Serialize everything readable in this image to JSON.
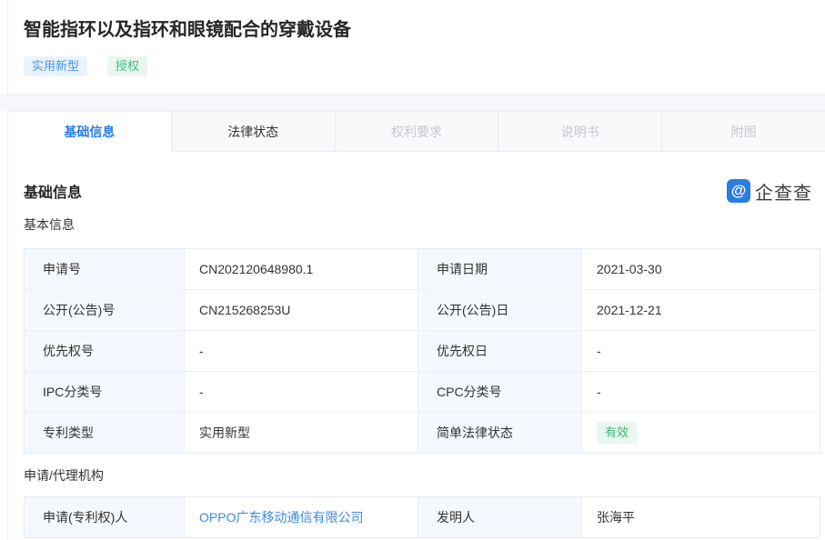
{
  "header": {
    "title": "智能指环以及指环和眼镜配合的穿戴设备",
    "tags": [
      {
        "id": "utility-model",
        "label": "实用新型",
        "style": "blue"
      },
      {
        "id": "granted",
        "label": "授权",
        "style": "green"
      }
    ]
  },
  "tabs": [
    {
      "id": "basic-info",
      "label": "基础信息",
      "state": "active"
    },
    {
      "id": "legal-status",
      "label": "法律状态",
      "state": "normal"
    },
    {
      "id": "claims",
      "label": "权利要求",
      "state": "disabled"
    },
    {
      "id": "description",
      "label": "说明书",
      "state": "disabled"
    },
    {
      "id": "drawings",
      "label": "附图",
      "state": "disabled"
    }
  ],
  "section": {
    "title": "基础信息",
    "brand_name": "企查查",
    "brand_icon_glyph": "@"
  },
  "basic_info": {
    "heading": "基本信息",
    "rows": [
      [
        {
          "label": "申请号",
          "value": "CN202120648980.1",
          "type": "text"
        },
        {
          "label": "申请日期",
          "value": "2021-03-30",
          "type": "text"
        }
      ],
      [
        {
          "label": "公开(公告)号",
          "value": "CN215268253U",
          "type": "text"
        },
        {
          "label": "公开(公告)日",
          "value": "2021-12-21",
          "type": "text"
        }
      ],
      [
        {
          "label": "优先权号",
          "value": "-",
          "type": "text"
        },
        {
          "label": "优先权日",
          "value": "-",
          "type": "text"
        }
      ],
      [
        {
          "label": "IPC分类号",
          "value": "-",
          "type": "text"
        },
        {
          "label": "CPC分类号",
          "value": "-",
          "type": "text"
        }
      ],
      [
        {
          "label": "专利类型",
          "value": "实用新型",
          "type": "text"
        },
        {
          "label": "简单法律状态",
          "value": "有效",
          "type": "badge"
        }
      ]
    ]
  },
  "applicant_info": {
    "heading": "申请/代理机构",
    "rows": [
      [
        {
          "label": "申请(专利权)人",
          "value": "OPPO广东移动通信有限公司",
          "type": "link"
        },
        {
          "label": "发明人",
          "value": "张海平",
          "type": "text"
        }
      ]
    ]
  },
  "colors": {
    "accent_blue": "#2b7ce6",
    "link_blue": "#4089dd",
    "tag_blue_bg": "#e8f3fd",
    "tag_blue_text": "#4a92e9",
    "tag_green_bg": "#e9f7ef",
    "tag_green_text": "#42ba7f",
    "badge_valid_bg": "#e8f7ef",
    "badge_valid_text": "#3db87a",
    "label_cell_bg": "#f3f9fe",
    "table_border": "#e4ebf3",
    "brand_blue": "#2a7de3"
  }
}
